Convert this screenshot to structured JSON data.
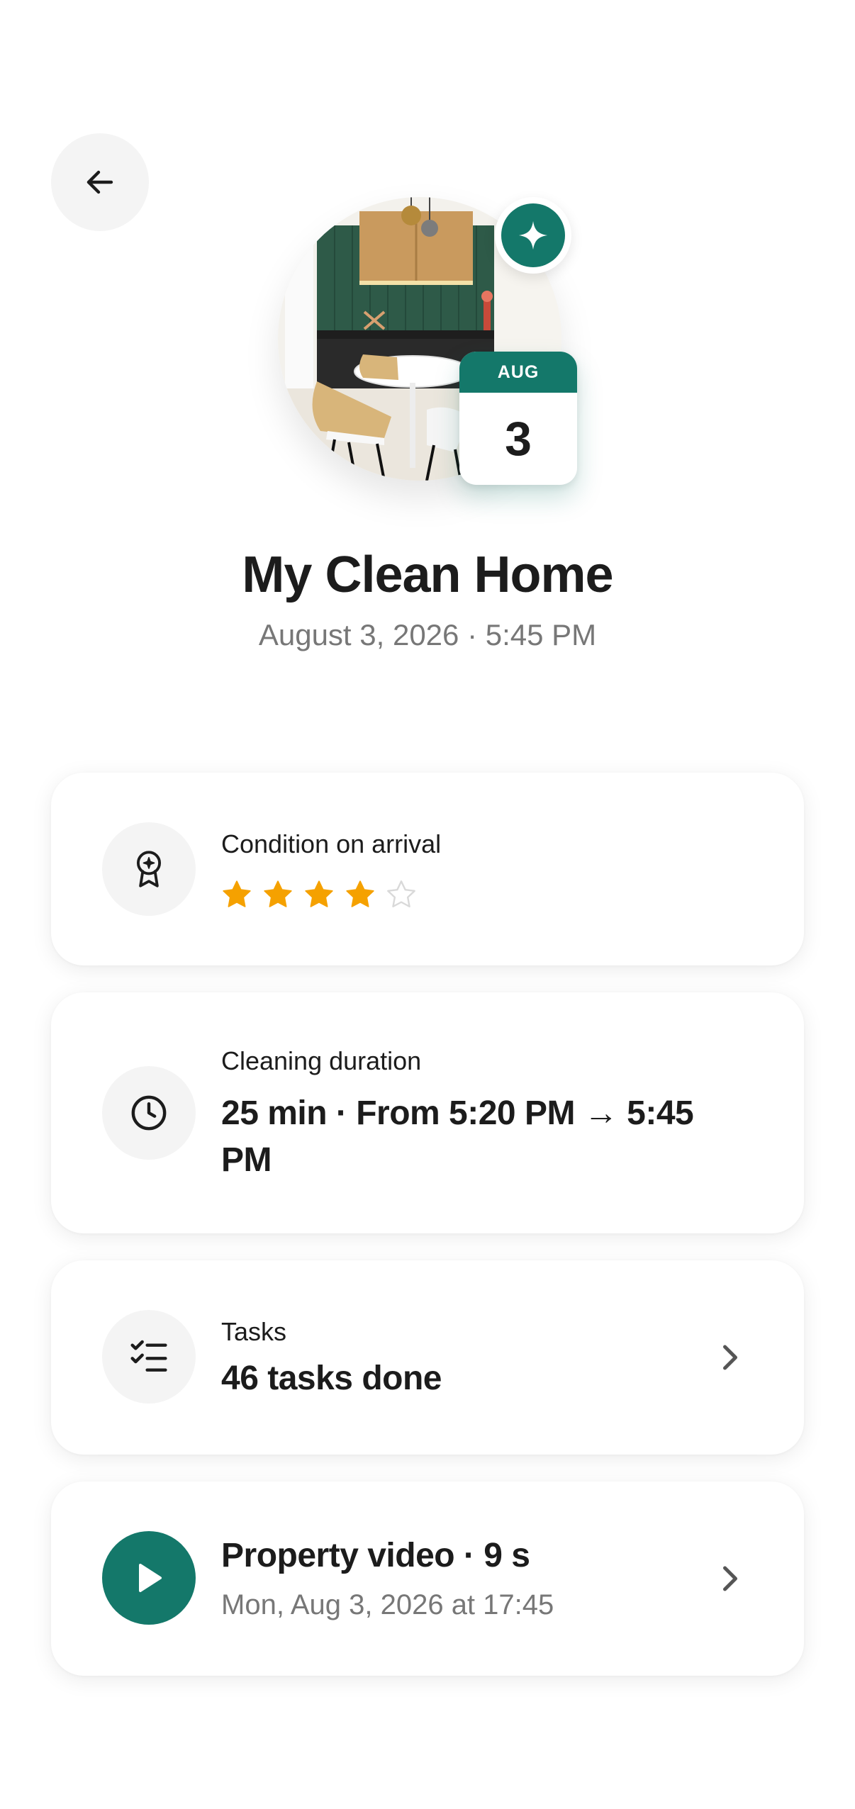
{
  "header": {
    "back_icon": "arrow-left-icon"
  },
  "hero": {
    "photo_alt": "kitchen-dining-room-photo",
    "badge_icon": "sparkle-icon",
    "calendar": {
      "month": "AUG",
      "day": "3"
    },
    "title": "My Clean Home",
    "subtitle": "August 3, 2026 · 5:45 PM"
  },
  "cards": {
    "condition": {
      "icon": "award-ribbon-icon",
      "label": "Condition on arrival",
      "rating": 4,
      "rating_max": 5
    },
    "duration": {
      "icon": "clock-icon",
      "label": "Cleaning duration",
      "value": "25 min · From 5:20 PM → 5:45 PM"
    },
    "tasks": {
      "icon": "checklist-icon",
      "label": "Tasks",
      "value": "46 tasks done",
      "chevron_icon": "chevron-right-icon"
    },
    "video": {
      "icon": "play-icon",
      "title": "Property video · 9 s",
      "subtitle": "Mon, Aug 3, 2026 at 17:45",
      "chevron_icon": "chevron-right-icon"
    }
  },
  "colors": {
    "accent": "#14786a",
    "star": "#f5a100",
    "star_empty": "#d9d9d9",
    "text_primary": "#1c1c1c",
    "text_secondary": "#777777",
    "icon_bg": "#f4f4f4"
  }
}
